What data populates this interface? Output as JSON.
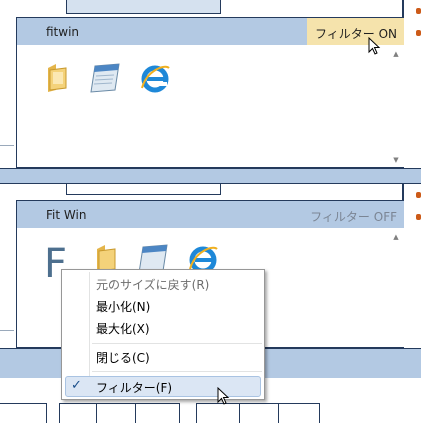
{
  "window1": {
    "title": "fitwin",
    "filter_label": "フィルター ON",
    "filter_on": true
  },
  "window2": {
    "title": "Fit Win",
    "filter_label": "フィルター OFF",
    "filter_on": false,
    "big_letter": "F"
  },
  "context_menu": {
    "items": [
      {
        "label": "元のサイズに戻す(R)",
        "enabled": false
      },
      {
        "label": "最小化(N)",
        "enabled": true
      },
      {
        "label": "最大化(X)",
        "enabled": true
      },
      {
        "label": "閉じる(C)",
        "enabled": true
      },
      {
        "label": "フィルター(F)",
        "enabled": true,
        "checked": true
      }
    ],
    "check_glyph": "✓"
  },
  "icons": [
    "folder-icon",
    "notepad-icon",
    "internet-explorer-icon"
  ],
  "colors": {
    "frame": "#243a5c",
    "titlebar": "#b3c9e3",
    "filter_on_bg": "#f5e3ac",
    "menu_highlight": "#dbe6f4"
  }
}
